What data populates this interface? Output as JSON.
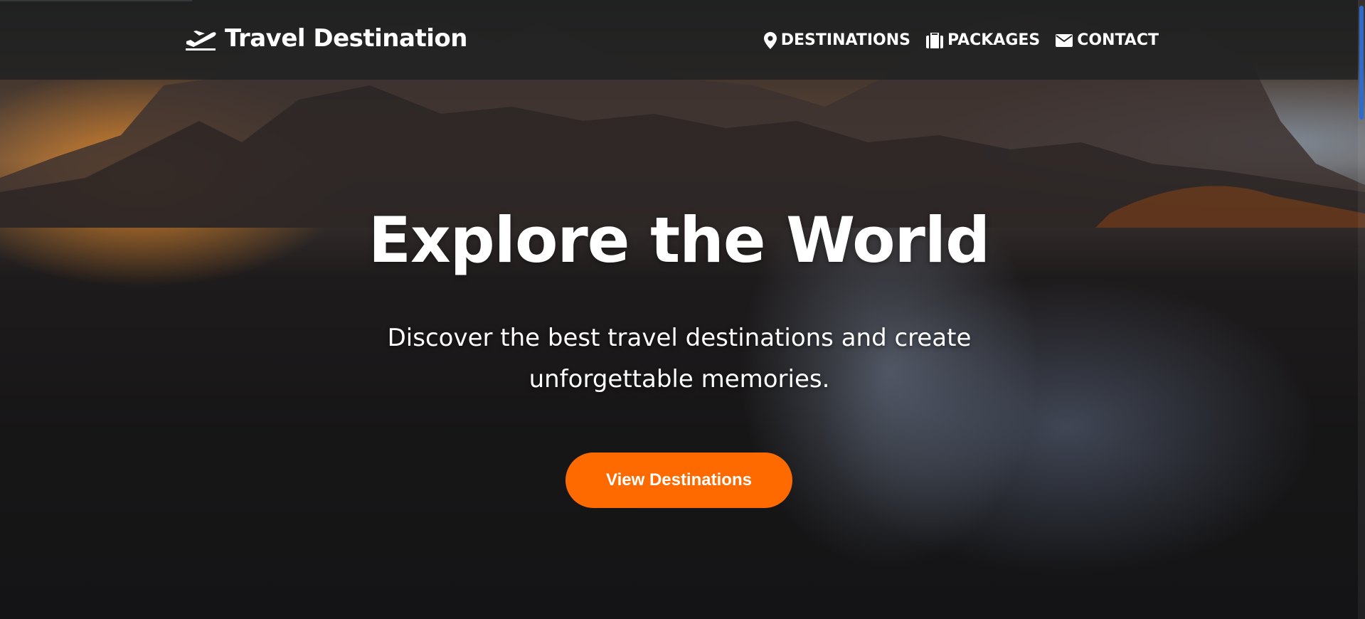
{
  "header": {
    "brand": "Travel Destination",
    "nav": [
      {
        "label": "DESTINATIONS",
        "icon": "map-pin-icon"
      },
      {
        "label": "PACKAGES",
        "icon": "suitcase-icon"
      },
      {
        "label": "CONTACT",
        "icon": "envelope-icon"
      }
    ]
  },
  "hero": {
    "title": "Explore the World",
    "subtitle": "Discover the best travel destinations and create unforgettable memories.",
    "cta_label": "View Destinations"
  },
  "colors": {
    "accent": "#ff6a00",
    "header_bg": "#1e2021",
    "text": "#ffffff",
    "scrollbar_thumb": "#2e6bd1"
  }
}
